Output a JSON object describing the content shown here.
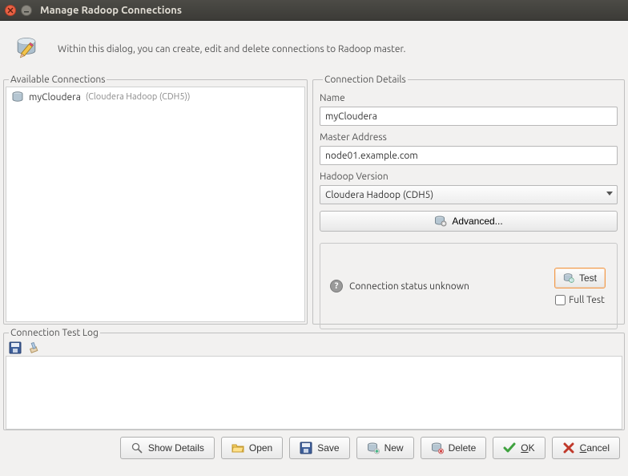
{
  "window": {
    "title": "Manage Radoop Connections",
    "description": "Within this dialog, you can create, edit and delete connections to Radoop master."
  },
  "available_connections": {
    "legend": "Available Connections",
    "items": [
      {
        "name": "myCloudera",
        "extra": "(Cloudera Hadoop (CDH5))"
      }
    ]
  },
  "details": {
    "legend": "Connection Details",
    "name_label": "Name",
    "name_value": "myCloudera",
    "master_label": "Master Address",
    "master_value": "node01.example.com",
    "version_label": "Hadoop Version",
    "version_value": "Cloudera Hadoop (CDH5)",
    "advanced_label": "Advanced...",
    "status_text": "Connection status unknown",
    "test_label": "Test",
    "full_test_label": "Full Test"
  },
  "log": {
    "legend": "Connection Test Log"
  },
  "buttons": {
    "show_details": "Show Details",
    "open": "Open",
    "save": "Save",
    "new": "New",
    "delete": "Delete",
    "ok": "OK",
    "cancel": "Cancel"
  }
}
